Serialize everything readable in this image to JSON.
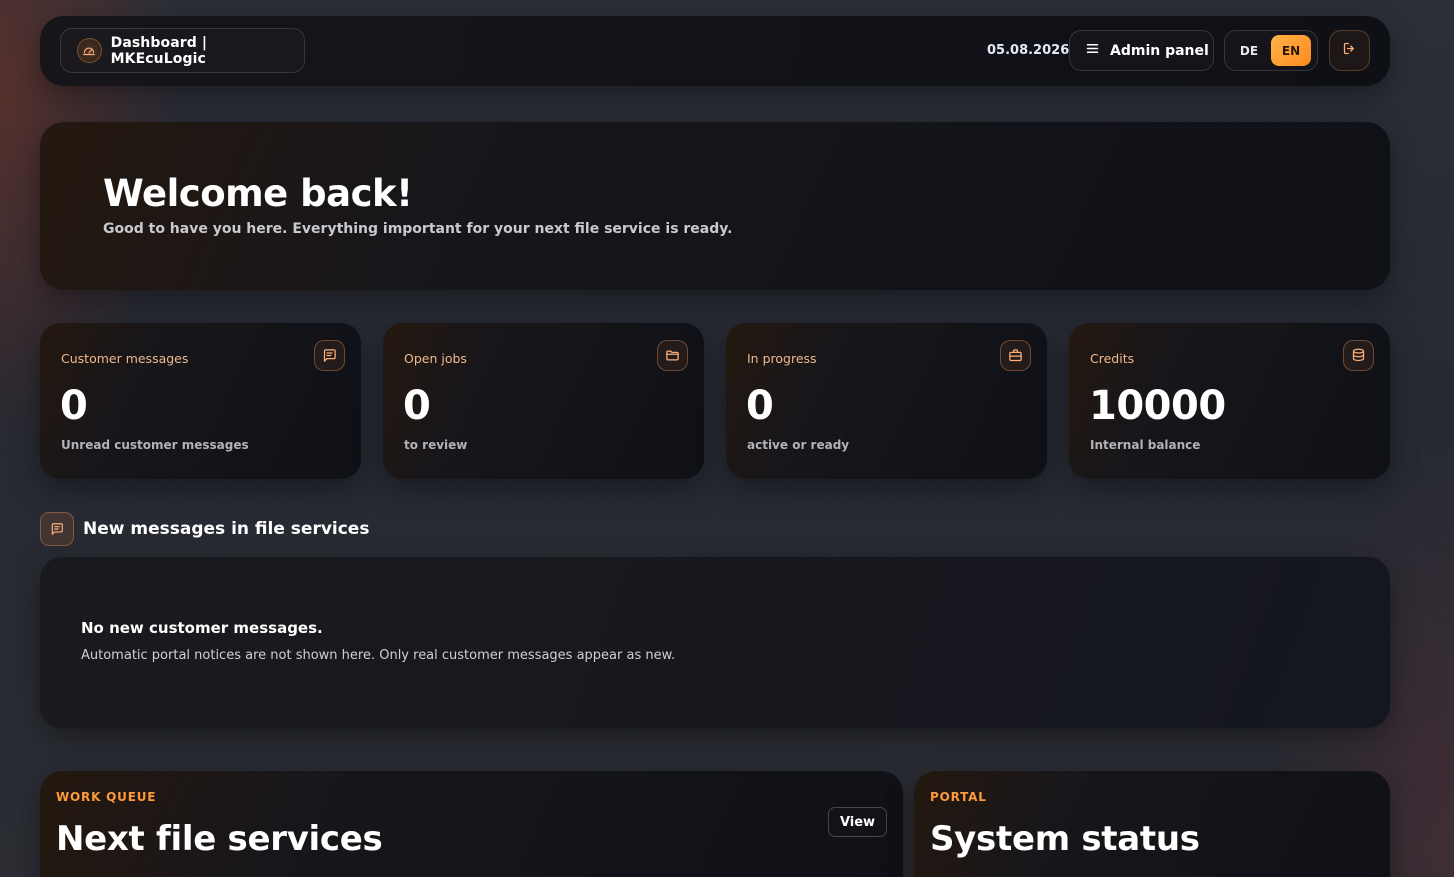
{
  "header": {
    "brand_title": "Dashboard | MKEcuLogic",
    "date": "05.08.2026",
    "admin_label": "Admin panel",
    "languages": [
      {
        "code": "DE",
        "active": false
      },
      {
        "code": "EN",
        "active": true
      }
    ]
  },
  "hero": {
    "title": "Welcome back!",
    "subtitle": "Good to have you here. Everything important for your next file service is ready."
  },
  "stats": [
    {
      "label": "Customer messages",
      "value": "0",
      "sub": "Unread customer messages",
      "icon": "message-icon"
    },
    {
      "label": "Open jobs",
      "value": "0",
      "sub": "to review",
      "icon": "folder-icon"
    },
    {
      "label": "In progress",
      "value": "0",
      "sub": "active or ready",
      "icon": "briefcase-icon"
    },
    {
      "label": "Credits",
      "value": "10000",
      "sub": "Internal balance",
      "icon": "database-icon"
    }
  ],
  "messages_section": {
    "title": "New messages in file services",
    "empty_title": "No new customer messages.",
    "empty_text": "Automatic portal notices are not shown here. Only real customer messages appear as new."
  },
  "work_queue": {
    "kicker": "WORK QUEUE",
    "title": "Next file services",
    "view_label": "View"
  },
  "portal": {
    "kicker": "PORTAL",
    "title": "System status"
  },
  "colors": {
    "accent": "#ff9a3c",
    "accent_light": "#f0b88e"
  }
}
